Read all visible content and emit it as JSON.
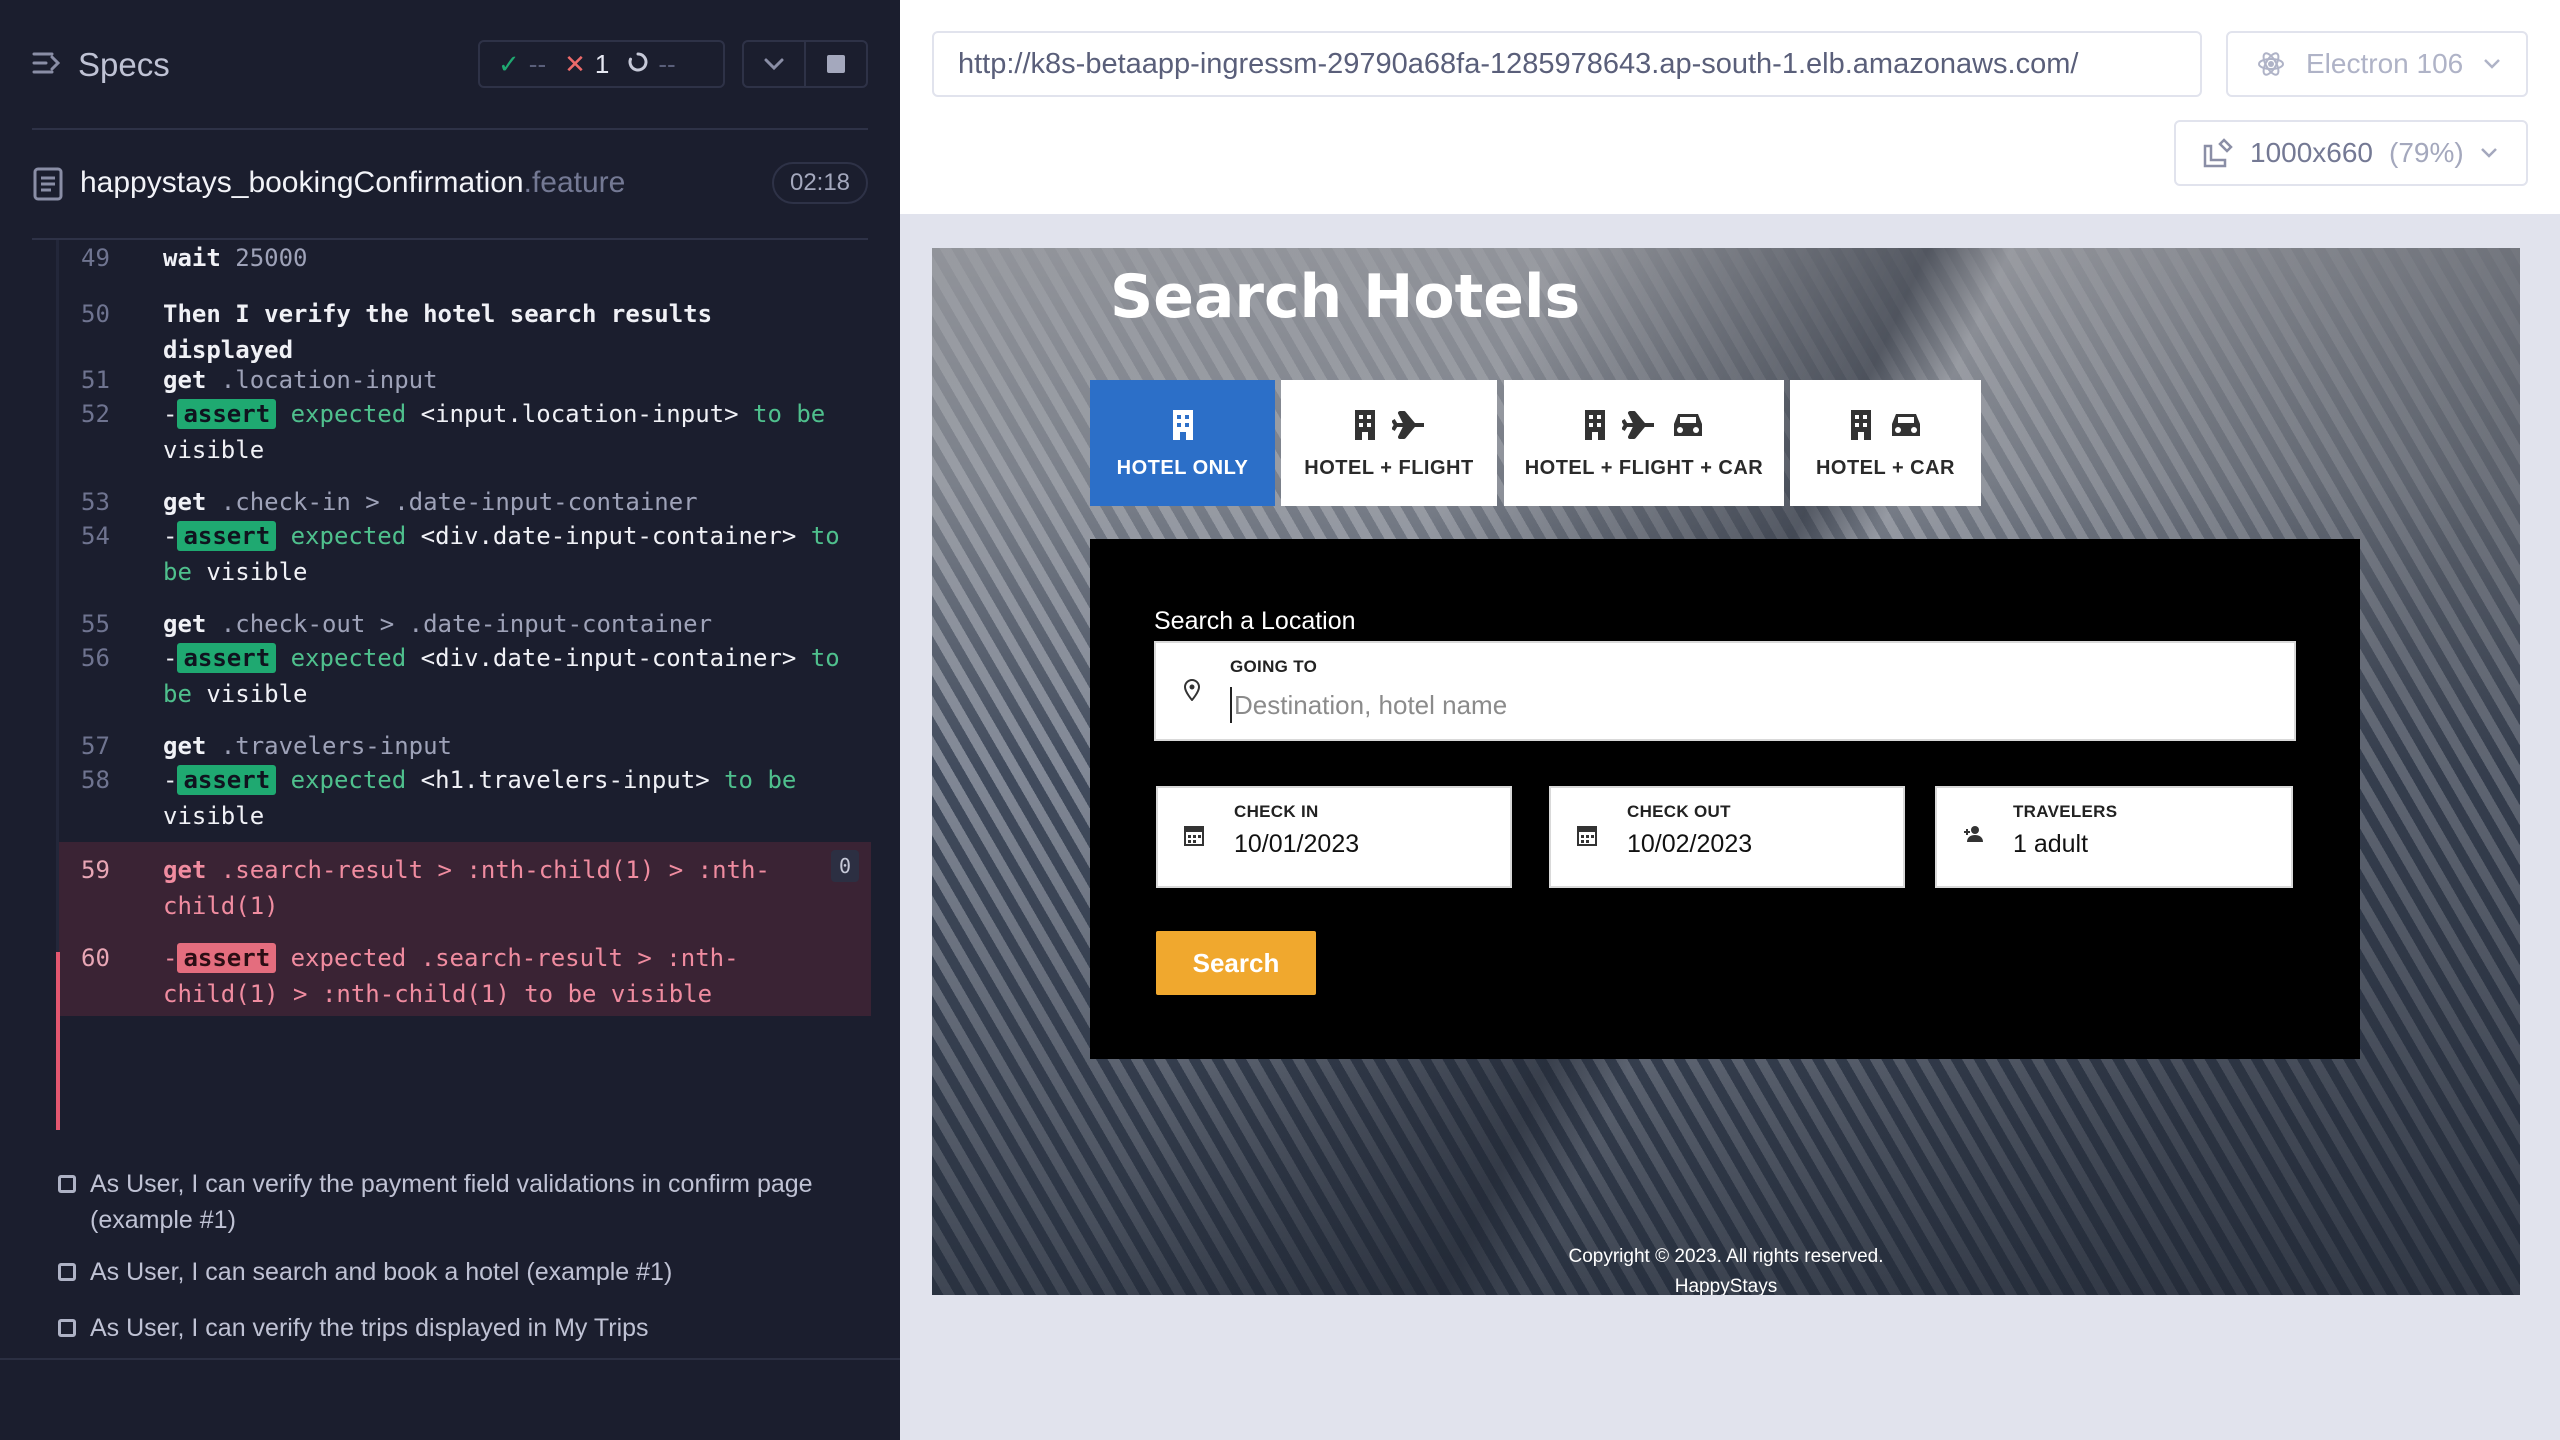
{
  "reporter": {
    "specs_label": "Specs",
    "stats": {
      "passed": "--",
      "failed": "1",
      "pending": "--"
    },
    "spec_file": {
      "name": "happystays_bookingConfirmation",
      "ext": ".feature",
      "duration": "02:18"
    },
    "commands": [
      {
        "line": "49",
        "parts": [
          {
            "t": "wait",
            "c": "kw"
          },
          {
            "t": "  25000",
            "c": "sel"
          }
        ]
      },
      {
        "line": "50",
        "parts": [
          {
            "t": "Then",
            "c": "kw"
          },
          {
            "t": "  I verify the hotel search results displayed",
            "c": "kw"
          }
        ]
      },
      {
        "line": "51",
        "parts": [
          {
            "t": "get",
            "c": "kw"
          },
          {
            "t": "  .location-input",
            "c": "sel"
          }
        ]
      },
      {
        "line": "52",
        "parts": [
          {
            "t": "-",
            "c": "white"
          },
          {
            "t": "assert",
            "c": "tag ok"
          },
          {
            "t": "  expected ",
            "c": "green"
          },
          {
            "t": "<input.location-input>",
            "c": "white"
          },
          {
            "t": "  to be",
            "c": "green"
          },
          {
            "t": " visible",
            "c": "white"
          }
        ]
      },
      {
        "line": "53",
        "parts": [
          {
            "t": "get",
            "c": "kw"
          },
          {
            "t": "  .check-in > .date-input-container",
            "c": "sel"
          }
        ]
      },
      {
        "line": "54",
        "parts": [
          {
            "t": "-",
            "c": "white"
          },
          {
            "t": "assert",
            "c": "tag ok"
          },
          {
            "t": "  expected ",
            "c": "green"
          },
          {
            "t": "<div.date-input-container>",
            "c": "white"
          },
          {
            "t": " to be",
            "c": "green"
          },
          {
            "t": " visible",
            "c": "white"
          }
        ]
      },
      {
        "line": "55",
        "parts": [
          {
            "t": "get",
            "c": "kw"
          },
          {
            "t": "  .check-out > .date-input-container",
            "c": "sel"
          }
        ]
      },
      {
        "line": "56",
        "parts": [
          {
            "t": "-",
            "c": "white"
          },
          {
            "t": "assert",
            "c": "tag ok"
          },
          {
            "t": "  expected ",
            "c": "green"
          },
          {
            "t": "<div.date-input-container>",
            "c": "white"
          },
          {
            "t": " to be",
            "c": "green"
          },
          {
            "t": " visible",
            "c": "white"
          }
        ]
      },
      {
        "line": "57",
        "parts": [
          {
            "t": "get",
            "c": "kw"
          },
          {
            "t": "  .travelers-input",
            "c": "sel"
          }
        ]
      },
      {
        "line": "58",
        "parts": [
          {
            "t": "-",
            "c": "white"
          },
          {
            "t": "assert",
            "c": "tag ok"
          },
          {
            "t": "  expected ",
            "c": "green"
          },
          {
            "t": "<h1.travelers-input>",
            "c": "white"
          },
          {
            "t": "  to be",
            "c": "green"
          },
          {
            "t": " visible",
            "c": "white"
          }
        ]
      },
      {
        "line": "59",
        "failed": true,
        "retry": "0",
        "parts": [
          {
            "t": "get",
            "c": "kw red"
          },
          {
            "t": "  .search-result > :nth-child(1) > :nth-child(1)",
            "c": "red"
          }
        ]
      },
      {
        "line": "60",
        "failed": true,
        "parts": [
          {
            "t": "-",
            "c": "red"
          },
          {
            "t": "assert",
            "c": "tag bad"
          },
          {
            "t": "  expected ",
            "c": "red"
          },
          {
            "t": ".search-result > :nth-child(1) > :nth-child(1)",
            "c": "red"
          },
          {
            "t": "  to be",
            "c": "red"
          },
          {
            "t": "  visible",
            "c": "red"
          }
        ]
      }
    ],
    "tests": [
      "As User, I can verify the payment field validations in confirm page (example #1)",
      "As User, I can search and book a hotel (example #1)",
      "As User, I can verify the trips displayed in My Trips"
    ]
  },
  "aut": {
    "url": "http://k8s-betaapp-ingressm-29790a68fa-1285978643.ap-south-1.elb.amazonaws.com/",
    "browser": "Electron 106",
    "viewport": "1000x660",
    "viewport_pct": "(79%)"
  },
  "app": {
    "title": "Search Hotels",
    "tabs": [
      "HOTEL ONLY",
      "HOTEL + FLIGHT",
      "HOTEL + FLIGHT + CAR",
      "HOTEL + CAR"
    ],
    "location_label": "Search a Location",
    "going_to_label": "GOING TO",
    "going_to_placeholder": "Destination, hotel name",
    "check_in_label": "CHECK IN",
    "check_in_value": "10/01/2023",
    "check_out_label": "CHECK OUT",
    "check_out_value": "10/02/2023",
    "travelers_label": "TRAVELERS",
    "travelers_value": "1 adult",
    "search_button": "Search",
    "copyright": "Copyright © 2023. All rights reserved.",
    "brand": "HappyStays"
  },
  "colors": {
    "reporter_bg": "#1b1e2e",
    "pass_green": "#1fa971",
    "fail_red": "#e45770",
    "active_tab_blue": "#2c6fc8",
    "search_orange": "#f0a82e"
  }
}
